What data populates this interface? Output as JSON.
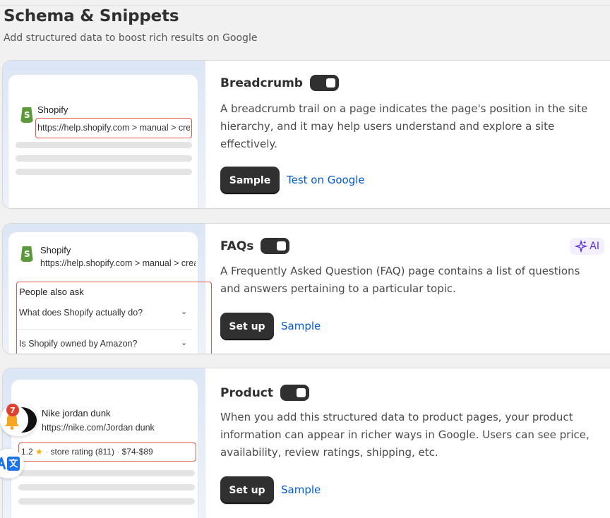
{
  "header": {
    "title": "Schema & Snippets",
    "subtitle": "Add structured data to boost rich results on Google"
  },
  "cards": [
    {
      "title": "Breadcrumb",
      "enabled": true,
      "description": "A breadcrumb trail on a page indicates the page's position in the site hierarchy, and it may help users understand and explore a site effectively.",
      "primary_button": "Sample",
      "secondary_link": "Test on Google",
      "preview": {
        "brand": "Shopify",
        "url": "https://help.shopify.com > manual > create"
      }
    },
    {
      "title": "FAQs",
      "enabled": true,
      "badge": "AI",
      "description": "A Frequently Asked Question (FAQ) page contains a list of questions and answers pertaining to a particular topic.",
      "primary_button": "Set up",
      "secondary_link": "Sample",
      "preview": {
        "brand": "Shopify",
        "url": "https://help.shopify.com > manual > create",
        "people_also_ask": "People also ask",
        "questions": [
          "What does Shopify actually do?",
          "Is Shopify owned by Amazon?"
        ]
      }
    },
    {
      "title": "Product",
      "enabled": true,
      "description": "When you add this structured data to product pages, your product information can appear in richer ways in Google. Users can see price, availability, review ratings, shipping, etc.",
      "primary_button": "Set up",
      "secondary_link": "Sample",
      "preview": {
        "product_name": "Nike jordan dunk",
        "url": "https://nike.com/Jordan dunk",
        "rating": "1.2",
        "store_rating": "store rating (811)",
        "price_range": "$74-$89"
      }
    }
  ],
  "floating": {
    "notification_count": "7"
  },
  "colors": {
    "accent_link": "#005bd3",
    "button_dark": "#303030",
    "highlight_red": "#e4584a",
    "ai_purple": "#5c2fd6"
  }
}
